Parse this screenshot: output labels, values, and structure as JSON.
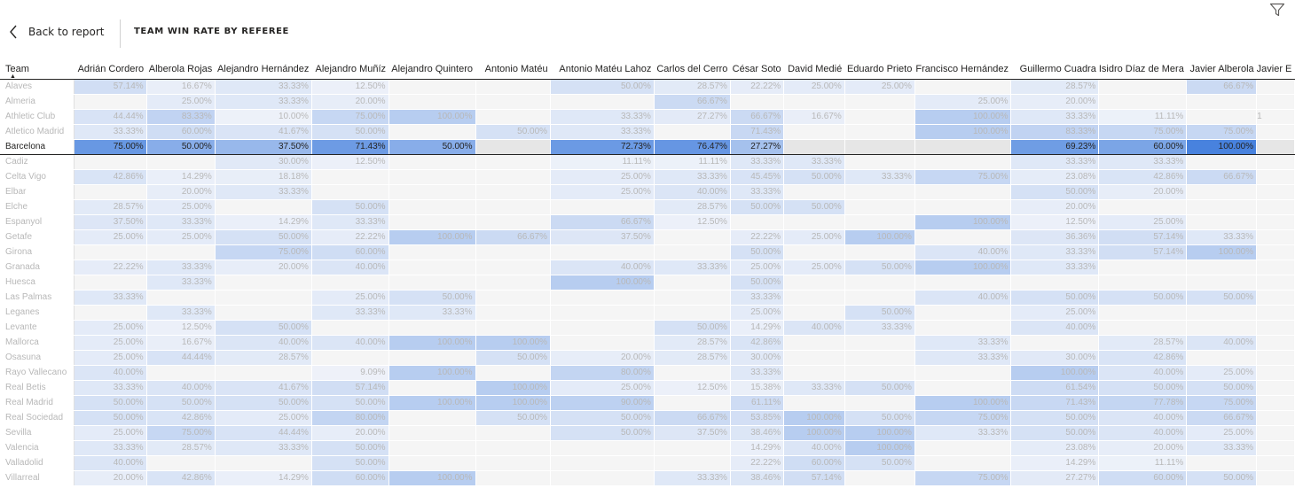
{
  "header": {
    "back_label": "Back to report",
    "title": "TEAM WIN RATE BY REFEREE"
  },
  "icons": {
    "back": "chevron-left-icon",
    "filter": "filter-icon"
  },
  "colors": {
    "text": "#252423",
    "muted": "#b8b8b8",
    "accent": "#4a86e0",
    "base_cell": "#f3f3f3"
  },
  "matrix": {
    "row_header": "Team",
    "highlight_row": "Barcelona",
    "columns": [
      "Adrián Cordero",
      "Alberola Rojas",
      "Alejandro Hernández",
      "Alejandro Muñíz",
      "Alejandro Quintero",
      "Antonio Matéu",
      "Antonio Matéu Lahoz",
      "Carlos del Cerro",
      "César Soto",
      "David Medié",
      "Eduardo Prieto",
      "Francisco Hernández",
      "Guillermo Cuadra",
      "Isidro Díaz de Mera",
      "Javier Alberola",
      "Javier E"
    ],
    "rows": [
      {
        "team": "Alaves",
        "values": [
          "57.14%",
          "16.67%",
          "33.33%",
          "12.50%",
          "",
          "",
          "50.00%",
          "28.57%",
          "22.22%",
          "25.00%",
          "25.00%",
          "",
          "28.57%",
          "",
          "66.67%",
          ""
        ]
      },
      {
        "team": "Almeria",
        "values": [
          "",
          "25.00%",
          "33.33%",
          "20.00%",
          "",
          "",
          "",
          "66.67%",
          "",
          "",
          "",
          "25.00%",
          "20.00%",
          "",
          "",
          ""
        ]
      },
      {
        "team": "Athletic Club",
        "values": [
          "44.44%",
          "83.33%",
          "10.00%",
          "75.00%",
          "100.00%",
          "",
          "33.33%",
          "27.27%",
          "66.67%",
          "16.67%",
          "",
          "100.00%",
          "33.33%",
          "11.11%",
          "",
          "1"
        ]
      },
      {
        "team": "Atletico Madrid",
        "values": [
          "33.33%",
          "60.00%",
          "41.67%",
          "50.00%",
          "",
          "50.00%",
          "33.33%",
          "",
          "71.43%",
          "",
          "",
          "100.00%",
          "83.33%",
          "75.00%",
          "75.00%",
          ""
        ]
      },
      {
        "team": "Barcelona",
        "values": [
          "75.00%",
          "50.00%",
          "37.50%",
          "71.43%",
          "50.00%",
          "",
          "72.73%",
          "76.47%",
          "27.27%",
          "",
          "",
          "",
          "69.23%",
          "60.00%",
          "100.00%",
          ""
        ]
      },
      {
        "team": "Cadiz",
        "values": [
          "",
          "",
          "30.00%",
          "12.50%",
          "",
          "",
          "11.11%",
          "11.11%",
          "33.33%",
          "33.33%",
          "",
          "",
          "33.33%",
          "33.33%",
          "",
          ""
        ]
      },
      {
        "team": "Celta Vigo",
        "values": [
          "42.86%",
          "14.29%",
          "18.18%",
          "",
          "",
          "",
          "25.00%",
          "33.33%",
          "45.45%",
          "50.00%",
          "33.33%",
          "75.00%",
          "23.08%",
          "42.86%",
          "66.67%",
          ""
        ]
      },
      {
        "team": "Elbar",
        "values": [
          "",
          "20.00%",
          "33.33%",
          "",
          "",
          "",
          "25.00%",
          "40.00%",
          "33.33%",
          "",
          "",
          "",
          "50.00%",
          "20.00%",
          "",
          ""
        ]
      },
      {
        "team": "Elche",
        "values": [
          "28.57%",
          "25.00%",
          "",
          "50.00%",
          "",
          "",
          "",
          "28.57%",
          "50.00%",
          "50.00%",
          "",
          "",
          "20.00%",
          "",
          "",
          ""
        ]
      },
      {
        "team": "Espanyol",
        "values": [
          "37.50%",
          "33.33%",
          "14.29%",
          "33.33%",
          "",
          "",
          "66.67%",
          "12.50%",
          "",
          "",
          "",
          "100.00%",
          "12.50%",
          "25.00%",
          "",
          ""
        ]
      },
      {
        "team": "Getafe",
        "values": [
          "25.00%",
          "25.00%",
          "50.00%",
          "22.22%",
          "100.00%",
          "66.67%",
          "37.50%",
          "",
          "22.22%",
          "25.00%",
          "100.00%",
          "",
          "36.36%",
          "57.14%",
          "33.33%",
          ""
        ]
      },
      {
        "team": "Girona",
        "values": [
          "",
          "",
          "75.00%",
          "60.00%",
          "",
          "",
          "",
          "",
          "50.00%",
          "",
          "",
          "40.00%",
          "33.33%",
          "57.14%",
          "100.00%",
          ""
        ]
      },
      {
        "team": "Granada",
        "values": [
          "22.22%",
          "33.33%",
          "20.00%",
          "40.00%",
          "",
          "",
          "40.00%",
          "33.33%",
          "25.00%",
          "25.00%",
          "50.00%",
          "100.00%",
          "33.33%",
          "",
          "",
          ""
        ]
      },
      {
        "team": "Huesca",
        "values": [
          "",
          "33.33%",
          "",
          "",
          "",
          "",
          "100.00%",
          "",
          "50.00%",
          "",
          "",
          "",
          "",
          "",
          "",
          ""
        ]
      },
      {
        "team": "Las Palmas",
        "values": [
          "33.33%",
          "",
          "",
          "25.00%",
          "50.00%",
          "",
          "",
          "",
          "33.33%",
          "",
          "",
          "40.00%",
          "50.00%",
          "50.00%",
          "50.00%",
          ""
        ]
      },
      {
        "team": "Leganes",
        "values": [
          "",
          "33.33%",
          "",
          "33.33%",
          "33.33%",
          "",
          "",
          "",
          "25.00%",
          "",
          "50.00%",
          "",
          "25.00%",
          "",
          "",
          ""
        ]
      },
      {
        "team": "Levante",
        "values": [
          "25.00%",
          "12.50%",
          "50.00%",
          "",
          "",
          "",
          "",
          "50.00%",
          "14.29%",
          "40.00%",
          "33.33%",
          "",
          "40.00%",
          "",
          "",
          ""
        ]
      },
      {
        "team": "Mallorca",
        "values": [
          "25.00%",
          "16.67%",
          "40.00%",
          "40.00%",
          "100.00%",
          "100.00%",
          "",
          "28.57%",
          "42.86%",
          "",
          "",
          "33.33%",
          "",
          "28.57%",
          "40.00%",
          ""
        ]
      },
      {
        "team": "Osasuna",
        "values": [
          "25.00%",
          "44.44%",
          "28.57%",
          "",
          "",
          "50.00%",
          "20.00%",
          "28.57%",
          "30.00%",
          "",
          "",
          "33.33%",
          "30.00%",
          "42.86%",
          "",
          ""
        ]
      },
      {
        "team": "Rayo Vallecano",
        "values": [
          "40.00%",
          "",
          "",
          "9.09%",
          "100.00%",
          "",
          "80.00%",
          "",
          "33.33%",
          "",
          "",
          "",
          "100.00%",
          "40.00%",
          "25.00%",
          ""
        ]
      },
      {
        "team": "Real Betis",
        "values": [
          "33.33%",
          "40.00%",
          "41.67%",
          "57.14%",
          "",
          "100.00%",
          "25.00%",
          "12.50%",
          "15.38%",
          "33.33%",
          "50.00%",
          "",
          "61.54%",
          "50.00%",
          "50.00%",
          ""
        ]
      },
      {
        "team": "Real Madrid",
        "values": [
          "50.00%",
          "50.00%",
          "50.00%",
          "50.00%",
          "100.00%",
          "100.00%",
          "90.00%",
          "",
          "61.11%",
          "",
          "",
          "100.00%",
          "71.43%",
          "77.78%",
          "75.00%",
          ""
        ]
      },
      {
        "team": "Real Sociedad",
        "values": [
          "50.00%",
          "42.86%",
          "25.00%",
          "80.00%",
          "",
          "50.00%",
          "50.00%",
          "66.67%",
          "53.85%",
          "100.00%",
          "50.00%",
          "75.00%",
          "50.00%",
          "40.00%",
          "66.67%",
          ""
        ]
      },
      {
        "team": "Sevilla",
        "values": [
          "25.00%",
          "75.00%",
          "44.44%",
          "20.00%",
          "",
          "",
          "50.00%",
          "37.50%",
          "38.46%",
          "100.00%",
          "100.00%",
          "33.33%",
          "50.00%",
          "40.00%",
          "25.00%",
          ""
        ]
      },
      {
        "team": "Valencia",
        "values": [
          "33.33%",
          "28.57%",
          "33.33%",
          "50.00%",
          "",
          "",
          "",
          "",
          "14.29%",
          "40.00%",
          "100.00%",
          "",
          "23.08%",
          "20.00%",
          "33.33%",
          ""
        ]
      },
      {
        "team": "Valladolid",
        "values": [
          "40.00%",
          "",
          "",
          "50.00%",
          "",
          "",
          "",
          "",
          "22.22%",
          "60.00%",
          "50.00%",
          "",
          "14.29%",
          "11.11%",
          "",
          ""
        ]
      },
      {
        "team": "Villarreal",
        "values": [
          "20.00%",
          "42.86%",
          "14.29%",
          "60.00%",
          "100.00%",
          "",
          "",
          "33.33%",
          "38.46%",
          "57.14%",
          "",
          "75.00%",
          "27.27%",
          "60.00%",
          "50.00%",
          ""
        ]
      }
    ]
  }
}
